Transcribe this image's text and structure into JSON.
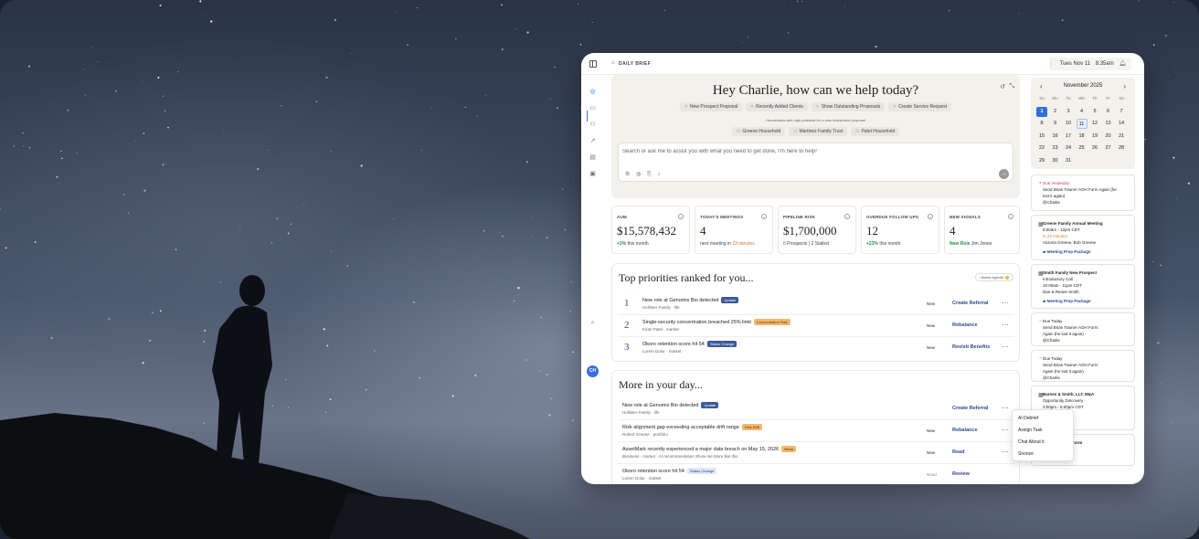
{
  "header": {
    "title": "DAILY BRIEF",
    "date": "Tues Nov 11",
    "time": "8:35am"
  },
  "rail": {
    "avatar_initials": "CH"
  },
  "hero": {
    "greeting": "Hey Charlie, how can we help today?",
    "quick_actions": [
      {
        "label": "New Prospect Proposal"
      },
      {
        "label": "Recently Added Clients"
      },
      {
        "label": "Show Outstanding Proposals"
      },
      {
        "label": "Create Service Request"
      }
    ],
    "households_label": "Households with high potential for a new investment proposal",
    "households": [
      {
        "label": "Greene Household"
      },
      {
        "label": "Martinez Family Trust"
      },
      {
        "label": "Patel Household"
      }
    ],
    "search_placeholder": "Search or ask me to assist you with what you need to get done, I'm here to help!"
  },
  "kpis": [
    {
      "label": "AUM",
      "value": "$15,578,432",
      "sub_highlight": "+3%",
      "sub": " this month"
    },
    {
      "label": "TODAY'S MEETINGS",
      "value": "4",
      "sub": "next meeting in ",
      "sub_highlight": "23 minutes"
    },
    {
      "label": "PIPELINE RISK",
      "value": "$1,700,000",
      "sub_highlight": "8",
      "sub": " Prospects | 2 Stalled"
    },
    {
      "label": "OVERDUE FOLLOW UPS",
      "value": "12",
      "sub_highlight": "+23%",
      "sub": " this month"
    },
    {
      "label": "NEW SIGNALS",
      "value": "4",
      "sub_highlight": "New Role",
      "sub": " Jim Jones"
    }
  ],
  "priorities": {
    "title": "Top priorities ranked for you...",
    "agents_label": "Active Agents",
    "rows": [
      {
        "num": "1",
        "title": "New role at Genomix Bio detected",
        "tag": "Update",
        "sub": "Hollister Family · life",
        "status": "New",
        "action": "Create Referral"
      },
      {
        "num": "2",
        "title": "Single-security concentration breached 25% limit",
        "tag": "Concentration Risk",
        "sub": "Kiran Patel · market",
        "status": "New",
        "action": "Rebalance"
      },
      {
        "num": "3",
        "title": "Okoro retention score hit 54",
        "tag": "Status Change",
        "sub": "Lorem Dolor · market",
        "status": "New",
        "action": "Revisit Benefits"
      }
    ]
  },
  "more": {
    "title": "More in your day...",
    "rows": [
      {
        "title": "New role at Genomix Bio detected",
        "tag": "Update",
        "sub": "Hollister Family · life",
        "status": "",
        "action": "Create Referral"
      },
      {
        "title": "Risk alignment gap exceeding acceptable drift range",
        "tag": "Risk Drift",
        "sub": "Robert Greene · portfolio",
        "status": "New",
        "action": "Rebalance"
      },
      {
        "title": "AssetMark recently experienced a major data breach on May 15, 2026",
        "tag": "News",
        "sub": "Business · market · AI recommendation Show me More like this",
        "status": "New",
        "action": "Read"
      },
      {
        "title": "Okoro retention score hit 54",
        "tag": "Status Change",
        "sub": "Lorem Dolor · market",
        "status": "Read",
        "action": "Review"
      }
    ],
    "menu": [
      "AI Debrief",
      "Assign Task",
      "Chat About it",
      "Snooze"
    ]
  },
  "calendar": {
    "month": "November 2025",
    "dow": [
      "Su",
      "Mo",
      "Tu",
      "We",
      "Th",
      "Fr",
      "Sa"
    ],
    "weeks": [
      [
        "",
        "",
        "",
        "",
        "",
        "",
        ""
      ],
      [
        "1",
        "2",
        "3",
        "4",
        "5",
        "6",
        "7"
      ],
      [
        "8",
        "9",
        "10",
        "11",
        "12",
        "13",
        "14"
      ],
      [
        "15",
        "16",
        "17",
        "18",
        "19",
        "20",
        "21"
      ],
      [
        "22",
        "23",
        "24",
        "25",
        "26",
        "27",
        "28"
      ],
      [
        "29",
        "30",
        "31",
        "",
        "",
        "",
        ""
      ]
    ]
  },
  "events": [
    {
      "kind": "due",
      "lines": [
        "Due Yesterday",
        "Send Brian Towner AOH Form Again (he",
        "lost it again)",
        "@Charlie"
      ]
    },
    {
      "kind": "meeting",
      "lines": [
        "Greene Family Annual Meeting",
        "9:00am - 12pm CDT",
        "in 23 minutes",
        "Victoria Greene, Bob Greene",
        "Meeting Prep Package"
      ]
    },
    {
      "kind": "meeting",
      "lines": [
        "Smith Family New Prospect",
        "Introductory Call",
        "10:00am - 11pm CDT",
        "Dan & Renee Smith",
        "Meeting Prep Package"
      ]
    },
    {
      "kind": "warn",
      "lines": [
        "Due Today",
        "Send Brian Towner AOH Form",
        "Again (he lost it again)",
        "@Charlie"
      ]
    },
    {
      "kind": "warn",
      "lines": [
        "Due Today",
        "Send Brian Towner AOH Form",
        "Again (he lost it again)",
        "@Charlie"
      ]
    },
    {
      "kind": "meeting",
      "lines": [
        "Barnes & Smith, LLC M&A",
        "Opportunity Discovery",
        "3:00pm - 5:00pm CDT",
        "es, Bob Smith",
        "Prep Package"
      ]
    },
    {
      "kind": "meeting",
      "lines": [
        "n Towner AOH Form",
        "t again)"
      ]
    }
  ]
}
